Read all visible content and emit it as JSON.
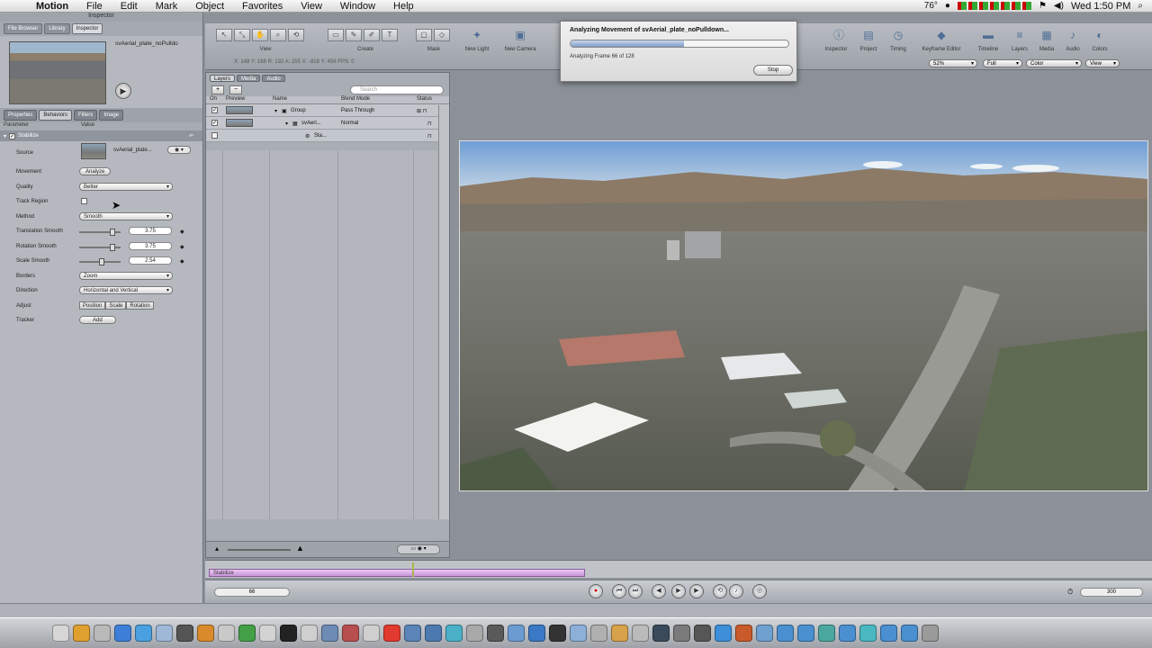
{
  "menubar": {
    "app": "Motion",
    "menus": [
      "File",
      "Edit",
      "Mark",
      "Object",
      "Favorites",
      "View",
      "Window",
      "Help"
    ],
    "temperature": "76°",
    "clock": "Wed 1:50 PM"
  },
  "inspector": {
    "title": "Inspector",
    "top_tabs": [
      "File Browser",
      "Library",
      "Inspector"
    ],
    "clip_name": "svAerial_plate_noPulldo",
    "sub_tabs": [
      "Properties",
      "Behaviors",
      "Filters",
      "Image"
    ],
    "columns": {
      "parameter": "Parameter",
      "value": "Value"
    },
    "behavior_name": "Stabilize",
    "params": {
      "source_label": "Source",
      "source_value": "svAerial_plate...",
      "movement_label": "Movement",
      "analyze_button": "Analyze",
      "quality_label": "Quality",
      "quality_value": "Better",
      "track_region_label": "Track Region",
      "method_label": "Method",
      "method_value": "Smooth",
      "translation_label": "Translation Smooth",
      "translation_value": "3.75",
      "translation_level": 0.8,
      "rotation_label": "Rotation Smooth",
      "rotation_value": "3.75",
      "rotation_level": 0.8,
      "scale_label": "Scale Smooth",
      "scale_value": "2.54",
      "scale_level": 0.55,
      "borders_label": "Borders",
      "borders_value": "Zoom",
      "direction_label": "Direction",
      "direction_value": "Horizontal and Vertical",
      "adjust_label": "Adjust",
      "adjust_options": [
        "Position",
        "Scale",
        "Rotation"
      ],
      "tracker_label": "Tracker",
      "tracker_button": "Add"
    }
  },
  "layers": {
    "tabs": [
      "Layers",
      "Media",
      "Audio"
    ],
    "search_placeholder": "Search",
    "columns": {
      "on": "On",
      "preview": "Preview",
      "name": "Name",
      "blend": "Blend Mode",
      "status": "Status"
    },
    "rows": [
      {
        "name": "Group",
        "blend": "Pass Through"
      },
      {
        "name": "svAeri...",
        "blend": "Normal"
      },
      {
        "name": "Sta..."
      }
    ]
  },
  "toolbar": {
    "labels": [
      "View",
      "Create",
      "Mask",
      "New Light",
      "New Camera"
    ],
    "right_labels": [
      "Inspector",
      "Project",
      "Timing",
      "Keyframe Editor",
      "Timeline",
      "Layers",
      "Media",
      "Audio",
      "Colors"
    ],
    "coords": "X: 148   Y: 168   R: 192   A: 255       X: -818   Y: 456       FPS: 0",
    "zoom": "52%",
    "resolution": "Full",
    "channels": "Color",
    "view": "View"
  },
  "dialog": {
    "title": "Analyzing Movement of svAerial_plate_noPulldown...",
    "status": "Analyzing Frame 66 of 128",
    "progress": 0.52,
    "stop_button": "Stop"
  },
  "timeline": {
    "bar_label": "Stabilize",
    "current_frame": "66",
    "end_frame": "300"
  },
  "colors": {
    "timeline_bar": "#d9a8e6",
    "inspector_bg": "#b5b9bf",
    "canvas_bg": "#8c9199"
  }
}
